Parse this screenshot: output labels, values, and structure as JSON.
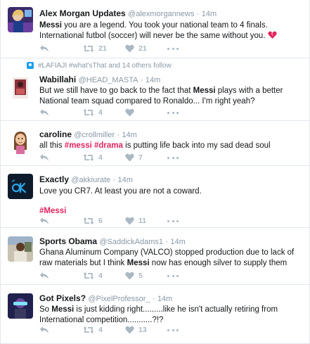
{
  "tweets": [
    {
      "name": "Alex Morgan Updates",
      "handle": "@alexmorgannews",
      "sep": "·",
      "time": "14m",
      "text_parts": [
        {
          "t": "Messi",
          "s": "b"
        },
        {
          "t": " you are a legend. You took your national team to 4 finals. International futbol (soccer) will never be the same without you.",
          "s": ""
        }
      ],
      "emoji": "broken-heart-icon",
      "retweets": "21",
      "likes": "21"
    },
    {
      "context": "#LAFIAJI #what'sThat and 14 others follow",
      "name": "Wabillahi",
      "handle": "@HEAD_MASTA",
      "sep": "·",
      "time": "14m",
      "text_parts": [
        {
          "t": "But we still have to go back to the fact that ",
          "s": ""
        },
        {
          "t": "Messi",
          "s": "b"
        },
        {
          "t": " plays with a better National team squad compared to Ronaldo... I'm right yeah?",
          "s": ""
        }
      ],
      "retweets": "4",
      "likes": ""
    },
    {
      "name": "caroline",
      "handle": "@crollmiller",
      "sep": "·",
      "time": "14m",
      "text_parts": [
        {
          "t": "all this ",
          "s": ""
        },
        {
          "t": "#messi",
          "s": "hash"
        },
        {
          "t": " ",
          "s": ""
        },
        {
          "t": "#drama",
          "s": "hash-plain"
        },
        {
          "t": " is putting life back into my sad dead soul",
          "s": ""
        }
      ],
      "retweets": "4",
      "likes": "7"
    },
    {
      "name": "Exactly",
      "handle": "@akkiurate",
      "sep": "·",
      "time": "14m",
      "text_parts": [
        {
          "t": "Love you CR7. At least you are not a coward.",
          "s": ""
        }
      ],
      "hashtag_line": "#Messi",
      "retweets": "6",
      "likes": "11"
    },
    {
      "name": "Sports Obama",
      "handle": "@SaddickAdams1",
      "sep": "·",
      "time": "14m",
      "text_parts": [
        {
          "t": "Ghana Aluminum Company (VALCO) stopped production due to lack of raw materials but I think ",
          "s": ""
        },
        {
          "t": "Messi",
          "s": "b"
        },
        {
          "t": " now has enough silver to supply them",
          "s": ""
        }
      ],
      "retweets": "4",
      "likes": "5"
    },
    {
      "name": "Got Pixels?",
      "handle": "@PixelProfessor_",
      "sep": "·",
      "time": "14m",
      "text_parts": [
        {
          "t": "So ",
          "s": ""
        },
        {
          "t": "Messi",
          "s": "b"
        },
        {
          "t": " is just kidding right.........like he isn't actually retiring from International competition...........?!?",
          "s": ""
        }
      ],
      "retweets": "4",
      "likes": "13"
    }
  ],
  "colors": {
    "retweet": "#aab8c2",
    "like": "#aab8c2",
    "hashtag": "#e0245e",
    "secondary_text": "#8899a6"
  },
  "icons": [
    "reply-icon",
    "retweet-icon",
    "like-icon",
    "more-icon",
    "broken-heart-icon",
    "follow-context-icon"
  ]
}
